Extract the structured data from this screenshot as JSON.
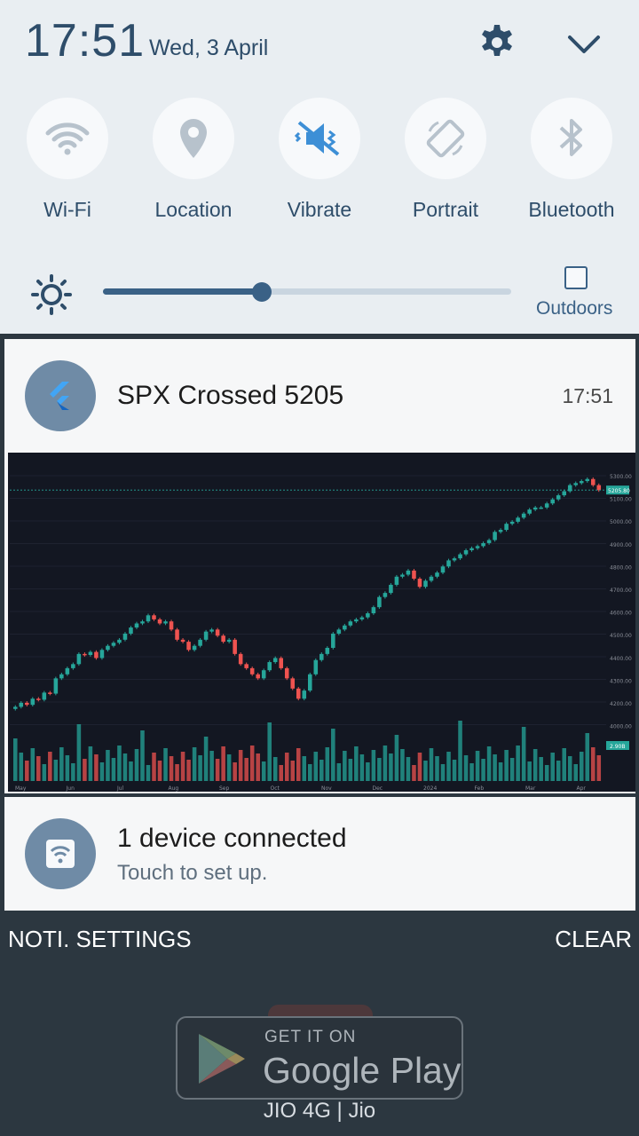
{
  "status": {
    "time": "17:51",
    "date": "Wed, 3 April"
  },
  "toggles": [
    {
      "label": "Wi-Fi",
      "icon": "wifi-icon"
    },
    {
      "label": "Location",
      "icon": "location-icon"
    },
    {
      "label": "Vibrate",
      "icon": "vibrate-icon"
    },
    {
      "label": "Portrait",
      "icon": "rotate-icon"
    },
    {
      "label": "Bluetooth",
      "icon": "bluetooth-icon"
    }
  ],
  "brightness": {
    "level": 0.39,
    "outdoors_label": "Outdoors",
    "outdoors_checked": false
  },
  "notifications": {
    "spx": {
      "title": "SPX Crossed 5205",
      "time": "17:51",
      "app_icon": "flutter-icon"
    },
    "wifi": {
      "title": "1 device connected",
      "subtitle": "Touch to set up.",
      "app_icon": "wifi-hotspot-icon"
    }
  },
  "actions": {
    "settings_label": "NOTI. SETTINGS",
    "clear_label": "CLEAR"
  },
  "background": {
    "badge_top": "GET IT ON",
    "badge_name": "Google Play",
    "carrier": "JIO 4G | Jio"
  },
  "colors": {
    "accent": "#2e4d6a",
    "panel_bg": "#e9eef2",
    "chart_bg": "#131722",
    "candle_up": "#26a69a",
    "candle_down": "#ef5350"
  },
  "chart_data": {
    "type": "candlestick",
    "x_tick_labels": [
      "May",
      "Jun",
      "Jul",
      "Aug",
      "Sep",
      "Oct",
      "Nov",
      "Dec",
      "2024",
      "Feb",
      "Mar",
      "Apr"
    ],
    "y_tick_labels": [
      "5300.00",
      "5100.00",
      "5000.00",
      "4900.00",
      "4800.00",
      "4700.00",
      "4600.00",
      "4500.00",
      "4400.00",
      "4300.00",
      "4200.00",
      "4000.00"
    ],
    "last_price_label": "5205.80",
    "volume_label": "2.90B",
    "ylim": [
      3950,
      5320
    ],
    "closes": [
      4140,
      4160,
      4150,
      4180,
      4175,
      4210,
      4205,
      4280,
      4300,
      4330,
      4350,
      4400,
      4395,
      4410,
      4380,
      4420,
      4440,
      4455,
      4470,
      4500,
      4530,
      4550,
      4560,
      4590,
      4570,
      4550,
      4560,
      4520,
      4470,
      4460,
      4420,
      4440,
      4470,
      4510,
      4520,
      4490,
      4460,
      4470,
      4400,
      4350,
      4330,
      4300,
      4280,
      4320,
      4360,
      4380,
      4330,
      4280,
      4230,
      4180,
      4220,
      4300,
      4370,
      4400,
      4430,
      4500,
      4520,
      4540,
      4560,
      4570,
      4580,
      4600,
      4630,
      4680,
      4700,
      4740,
      4780,
      4790,
      4810,
      4770,
      4730,
      4760,
      4780,
      4800,
      4830,
      4860,
      4870,
      4890,
      4910,
      4920,
      4930,
      4945,
      4960,
      5000,
      5010,
      5040,
      5050,
      5070,
      5090,
      5110,
      5120,
      5120,
      5140,
      5160,
      5180,
      5200,
      5230,
      5240,
      5250,
      5260,
      5230,
      5205
    ]
  }
}
